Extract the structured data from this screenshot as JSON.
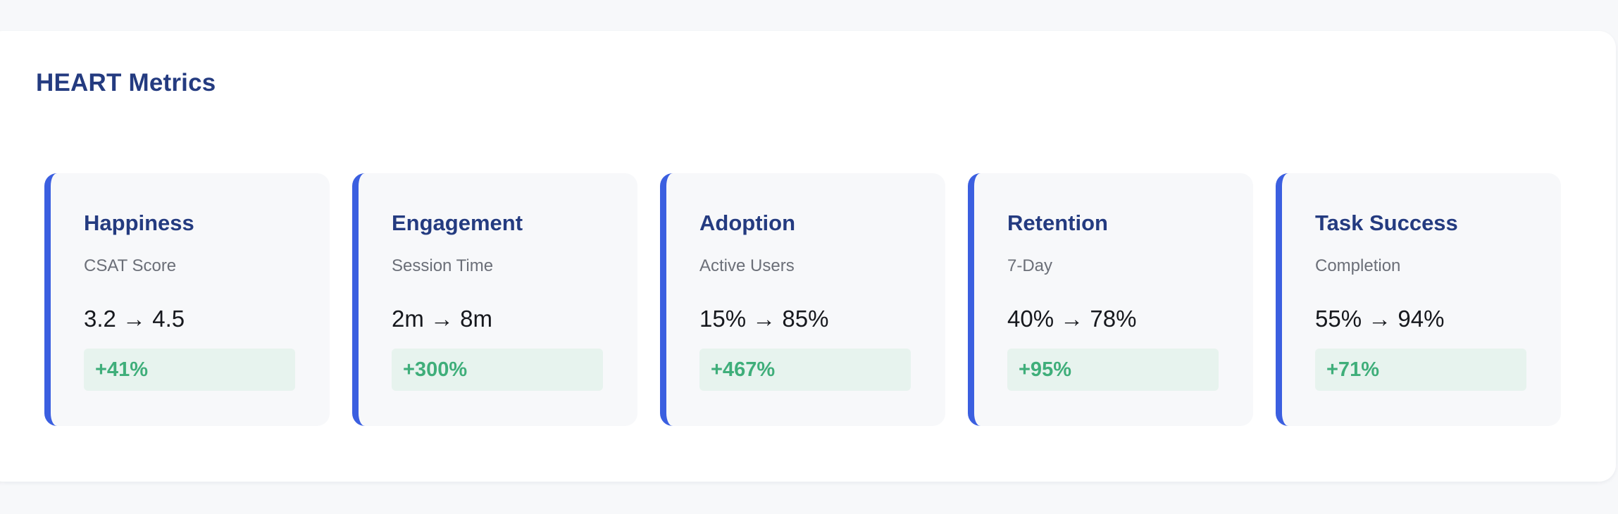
{
  "panel": {
    "title": "HEART Metrics"
  },
  "metrics": [
    {
      "title": "Happiness",
      "subtitle": "CSAT Score",
      "value": "3.2 → 4.5",
      "change": "+41%"
    },
    {
      "title": "Engagement",
      "subtitle": "Session Time",
      "value": "2m → 8m",
      "change": "+300%"
    },
    {
      "title": "Adoption",
      "subtitle": "Active Users",
      "value": "15% → 85%",
      "change": "+467%"
    },
    {
      "title": "Retention",
      "subtitle": "7-Day",
      "value": "40% → 78%",
      "change": "+95%"
    },
    {
      "title": "Task Success",
      "subtitle": "Completion",
      "value": "55% → 94%",
      "change": "+71%"
    }
  ],
  "colors": {
    "accent": "#3b5fe0",
    "title": "#243b80",
    "positive": "#3fae7a",
    "positive_bg": "#e7f3ee"
  }
}
